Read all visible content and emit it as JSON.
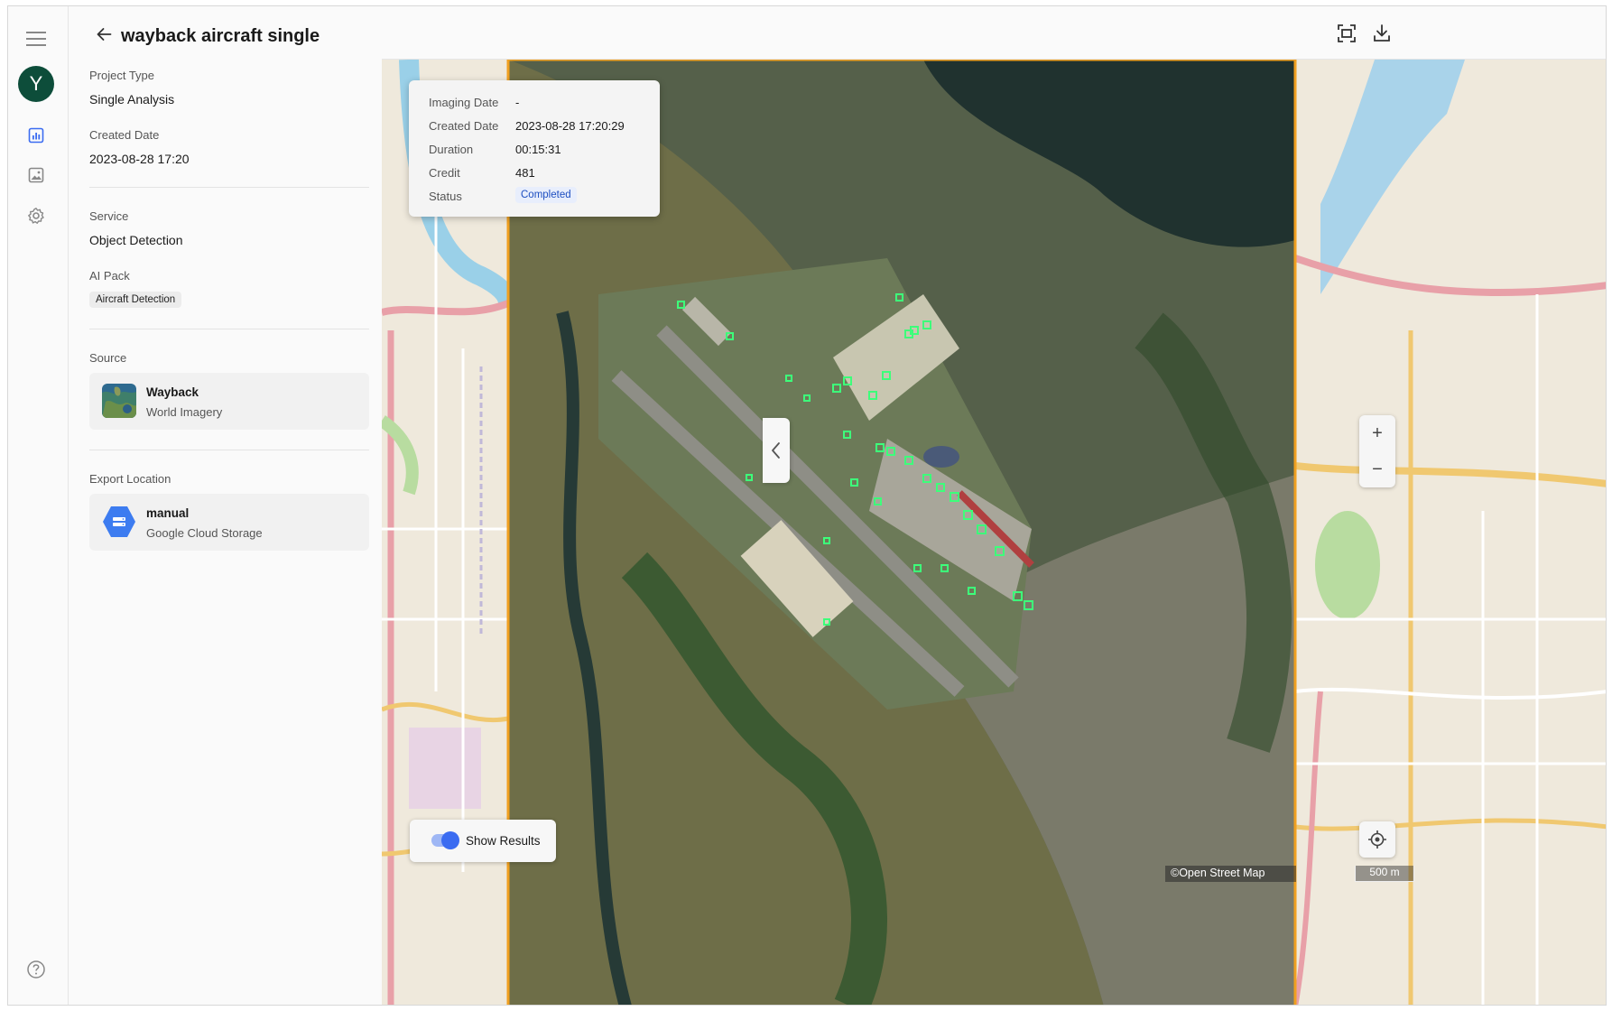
{
  "nav": {
    "avatar_initial": "Y",
    "icons": [
      "menu-icon",
      "report-icon",
      "image-icon",
      "settings-icon",
      "help-icon"
    ]
  },
  "project": {
    "title": "wayback aircraft single",
    "project_type_label": "Project Type",
    "project_type": "Single Analysis",
    "created_date_label": "Created Date",
    "created_date": "2023-08-28 17:20",
    "service_label": "Service",
    "service": "Object Detection",
    "ai_pack_label": "AI Pack",
    "ai_pack": "Aircraft Detection",
    "source_label": "Source",
    "source_title": "Wayback",
    "source_sub": "World Imagery",
    "export_label": "Export Location",
    "export_title": "manual",
    "export_sub": "Google Cloud Storage"
  },
  "popup": {
    "imaging_date_label": "Imaging Date",
    "imaging_date": "-",
    "created_date_label": "Created Date",
    "created_date": "2023-08-28 17:20:29",
    "duration_label": "Duration",
    "duration": "00:15:31",
    "credit_label": "Credit",
    "credit": "481",
    "status_label": "Status",
    "status": "Completed"
  },
  "map": {
    "show_results_label": "Show Results",
    "show_results_on": true,
    "zoom_in": "+",
    "zoom_out": "−",
    "attribution": "©Open Street Map",
    "scale_label": "500 m",
    "colors": {
      "aoi_border": "#f0a020",
      "detection": "#3dff7a",
      "accent": "#3b6cf1"
    }
  }
}
